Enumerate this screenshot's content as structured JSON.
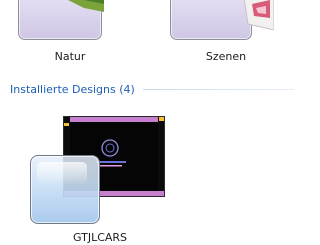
{
  "theme_tiles": [
    {
      "label": "Natur"
    },
    {
      "label": "Szenen"
    }
  ],
  "section": {
    "title": "Installierte Designs (4)"
  },
  "installed_tiles": [
    {
      "label": "GTJLCARS",
      "preview_text": "...STARFLEET..."
    }
  ],
  "colors": {
    "section_title": "#1e5fb5",
    "preview_bg": "#050506",
    "preview_bar": "#c77fcf",
    "preview_accent": "#f2c233"
  }
}
